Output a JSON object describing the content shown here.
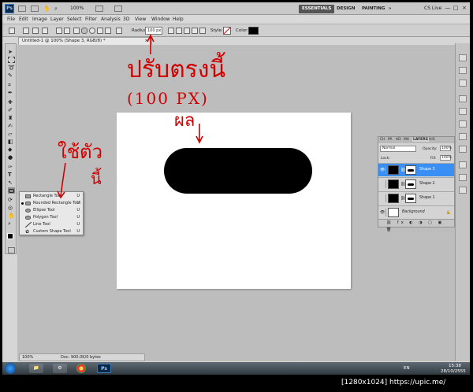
{
  "app": {
    "logo": "Ps",
    "zoom": "100%",
    "workspaces": [
      "ESSENTIALS",
      "DESIGN",
      "PAINTING",
      "»"
    ],
    "cs_live": "CS Live",
    "window_controls": [
      "—",
      "□",
      "×"
    ]
  },
  "menu": [
    "File",
    "Edit",
    "Image",
    "Layer",
    "Select",
    "Filter",
    "Analysis",
    "3D",
    "View",
    "Window",
    "Help"
  ],
  "options": {
    "radius_label": "Radius:",
    "radius_value": "100 px",
    "style_label": "Style:",
    "color_label": "Color:",
    "color_value": "#000000"
  },
  "document": {
    "tab_title": "Untitled-1 @ 100% (Shape 3, RGB/8) *",
    "tab_close": "×",
    "shape_color": "#000000",
    "status": "Doc: 900.0K/0 bytes",
    "status_zoom": "100%"
  },
  "tool_flyout": [
    {
      "label": "Rectangle Tool",
      "key": "U",
      "icon": "rectangle-icon",
      "selected": false
    },
    {
      "label": "Rounded Rectangle Tool",
      "key": "U",
      "icon": "rounded-rectangle-icon",
      "selected": true
    },
    {
      "label": "Ellipse Tool",
      "key": "U",
      "icon": "ellipse-icon",
      "selected": false
    },
    {
      "label": "Polygon Tool",
      "key": "U",
      "icon": "polygon-icon",
      "selected": false
    },
    {
      "label": "Line Tool",
      "key": "U",
      "icon": "line-icon",
      "selected": false
    },
    {
      "label": "Custom Shape Tool",
      "key": "U",
      "icon": "custom-shape-icon",
      "selected": false
    }
  ],
  "layers_panel": {
    "tabs": [
      "CH",
      "PA",
      "AD",
      "MA",
      "LAYERS",
      "HIS"
    ],
    "blend_mode": "Normal",
    "opacity_label": "Opacity:",
    "opacity_value": "100%",
    "lock_label": "Lock:",
    "fill_label": "Fill:",
    "fill_value": "100%",
    "layers": [
      {
        "name": "Shape 3",
        "selected": true
      },
      {
        "name": "Shape 2",
        "selected": false
      },
      {
        "name": "Shape 1",
        "selected": false
      },
      {
        "name": "Background",
        "selected": false
      }
    ],
    "footer_icons": "⛓ fx ◐ ◑ ▢ ▣ 🗑"
  },
  "annotations": {
    "top": "ปรับตรงนี้",
    "middle": "(100 PX)",
    "result": "ผล",
    "left": "ใช้ตัว",
    "left2": "นี้",
    "color": "#d10000"
  },
  "taskbar": {
    "lang": "EN",
    "time": "15:38",
    "date": "28/10/2555",
    "ps_label": "Ps"
  },
  "caption": "[1280x1024] https://upic.me/"
}
